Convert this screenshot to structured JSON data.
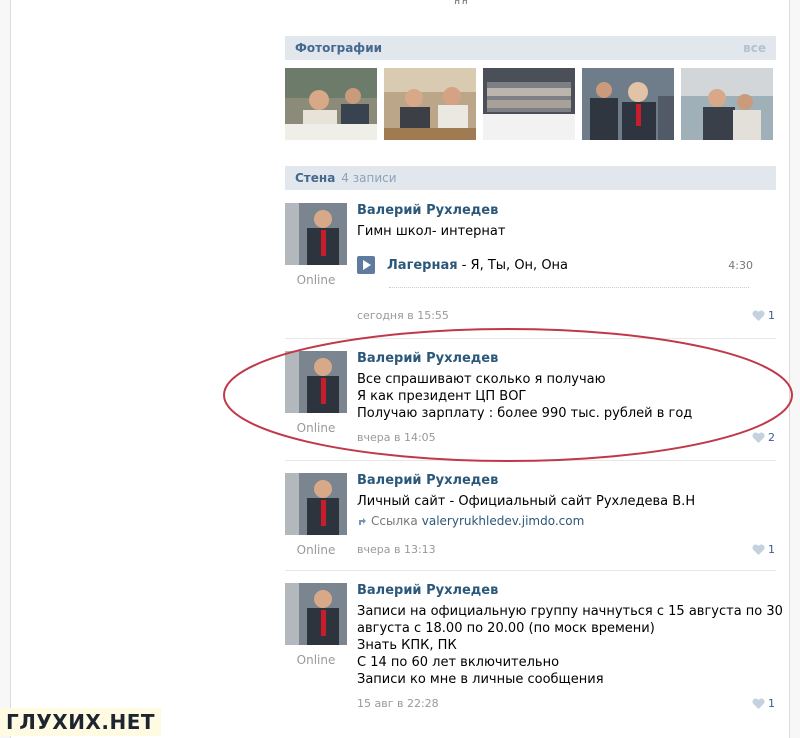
{
  "top_fragment": "дд",
  "photos_section": {
    "title": "Фотографии",
    "all_label": "все"
  },
  "wall_section": {
    "title": "Стена",
    "count": "4 записи"
  },
  "posts": [
    {
      "author": "Валерий Рухледев",
      "online": "Online",
      "lines": [
        "Гимн школ- интернат"
      ],
      "audio": {
        "artist": "Лагерная",
        "track": " - Я, Ты, Он, Она",
        "duration": "4:30"
      },
      "date": "сегодня в 15:55",
      "likes": "1"
    },
    {
      "author": "Валерий Рухледев",
      "online": "Online",
      "lines": [
        "Все спрашивают сколько я получаю",
        "Я как президент ЦП ВОГ",
        "Получаю зарплату : более 990 тыс. рублей в год"
      ],
      "date": "вчера в 14:05",
      "likes": "2"
    },
    {
      "author": "Валерий Рухледев",
      "online": "Online",
      "lines": [
        "Личный сайт - Официальный сайт Рухледева В.Н"
      ],
      "link": {
        "label": "Ссылка",
        "url": "valeryrukhledev.jimdo.com"
      },
      "date": "вчера в 13:13",
      "likes": "1"
    },
    {
      "author": "Валерий Рухледев",
      "online": "Online",
      "lines": [
        "Записи на официальную группу начнуться с 15 августа по 30",
        "августа с 18.00 по 20.00 (по моск времени)",
        "Знать КПК, ПК",
        "С 14 по 60 лет включительно",
        "Записи ко мне в личные сообщения"
      ],
      "date": "15 авг в 22:28",
      "likes": "1"
    }
  ],
  "watermark": "ГЛУХИХ.НЕТ",
  "colors": {
    "link": "#2b587a",
    "header_bg": "#e1e7ed",
    "highlight": "#c0394a"
  }
}
